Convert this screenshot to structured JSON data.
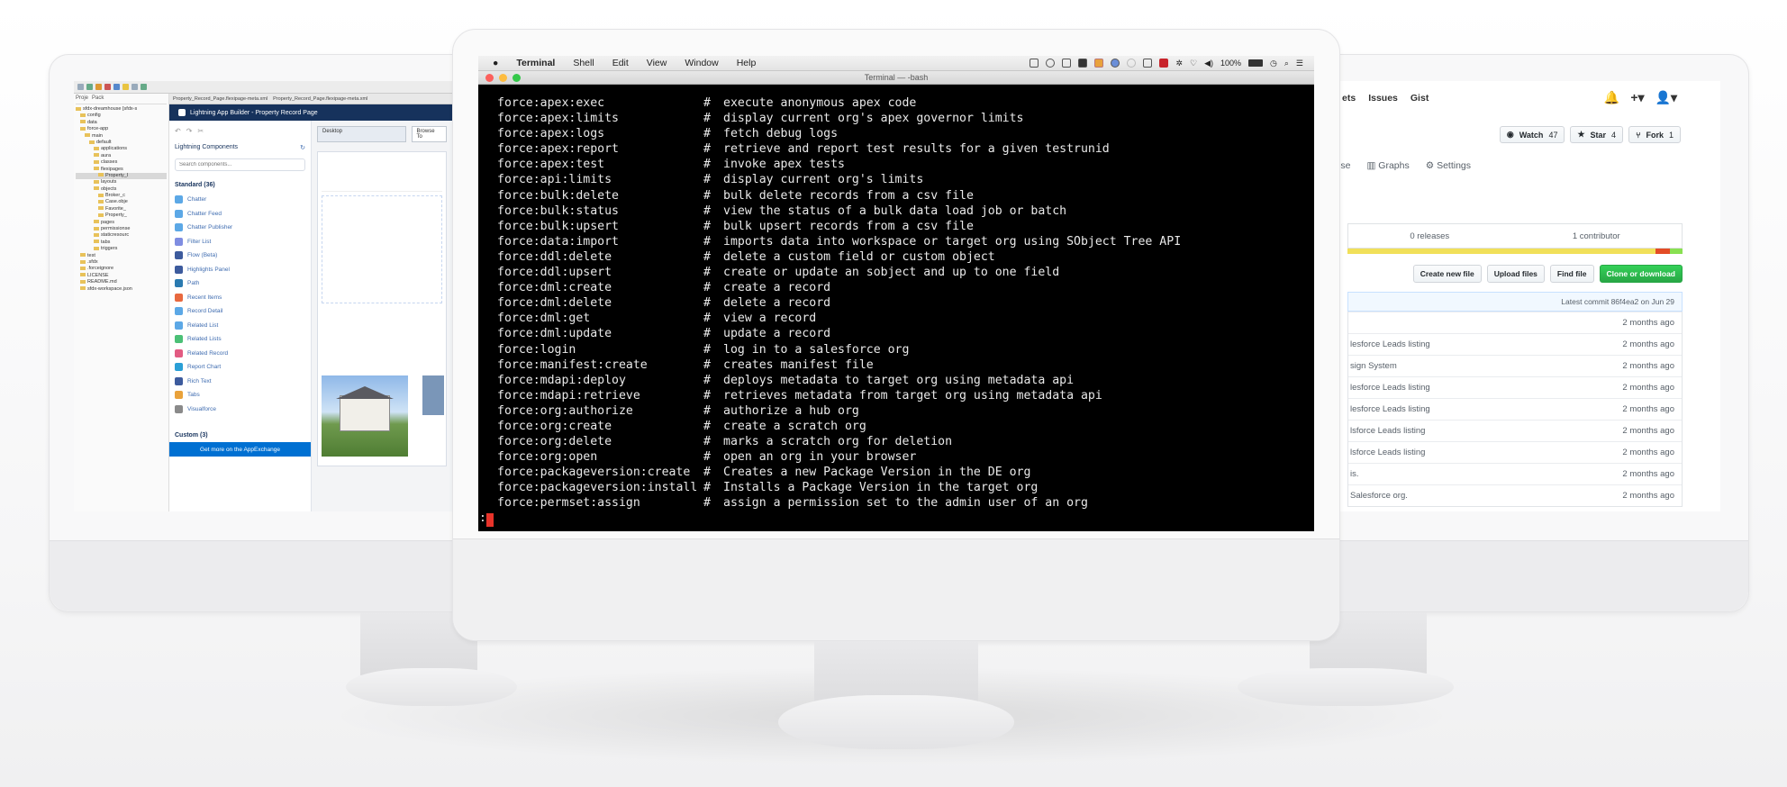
{
  "left_screen": {
    "ide_tabs": [
      "Property_Record_Page.flexipage-meta.xml",
      "Property_Record_Page.flexipage-meta.xml"
    ],
    "tree_tabs": [
      "Proje",
      "Pack"
    ],
    "tree_items": [
      "sfdx-dreamhouse [sfdx-s",
      "config",
      "data",
      "force-app",
      "main",
      "default",
      "applications",
      "aura",
      "classes",
      "flexipages",
      "Property_I",
      "layouts",
      "objects",
      "Broker_c",
      "Case.obje",
      "Favorite_",
      "Property_",
      "pages",
      "permissionse",
      "staticresourc",
      "tabs",
      "triggers",
      "test",
      ".sfdx",
      ".forceignore",
      "LICENSE",
      "README.md",
      "sfdx-workspace.json"
    ],
    "app_header": "Lightning App Builder - Property Record Page",
    "device_select": "Desktop",
    "palette_title": "Lightning Components",
    "palette_search_placeholder": "Search components...",
    "standard_heading": "Standard (36)",
    "components": [
      "Chatter",
      "Chatter Feed",
      "Chatter Publisher",
      "Filter List",
      "Flow (Beta)",
      "Highlights Panel",
      "Path",
      "Recent Items",
      "Record Detail",
      "Related List",
      "Related Lists",
      "Related Record",
      "Report Chart",
      "Rich Text",
      "Tabs",
      "Visualforce"
    ],
    "custom_heading": "Custom (3)",
    "appexchange_link": "Get more on the AppExchange",
    "browse_label": "Browse To"
  },
  "terminal": {
    "menu": {
      "apple": "",
      "app": "Terminal",
      "items": [
        "Shell",
        "Edit",
        "View",
        "Window",
        "Help"
      ],
      "battery": "100%"
    },
    "window_title": "Terminal — -bash",
    "lines": [
      {
        "cmd": "force:apex:exec",
        "desc": "execute anonymous apex code"
      },
      {
        "cmd": "force:apex:limits",
        "desc": "display current org's apex governor limits"
      },
      {
        "cmd": "force:apex:logs",
        "desc": "fetch debug logs"
      },
      {
        "cmd": "force:apex:report",
        "desc": "retrieve and report test results for a given testrunid"
      },
      {
        "cmd": "force:apex:test",
        "desc": "invoke apex tests"
      },
      {
        "cmd": "force:api:limits",
        "desc": "display current org's limits"
      },
      {
        "cmd": "force:bulk:delete",
        "desc": "bulk delete records from a csv file"
      },
      {
        "cmd": "force:bulk:status",
        "desc": "view the status of a bulk data load job or batch"
      },
      {
        "cmd": "force:bulk:upsert",
        "desc": "bulk upsert records from a csv file"
      },
      {
        "cmd": "force:data:import",
        "desc": "imports data into workspace or target org using SObject Tree API"
      },
      {
        "cmd": "force:ddl:delete",
        "desc": "delete a custom field or custom object"
      },
      {
        "cmd": "force:ddl:upsert",
        "desc": "create or update an sobject and up to one field"
      },
      {
        "cmd": "force:dml:create",
        "desc": "create a record"
      },
      {
        "cmd": "force:dml:delete",
        "desc": "delete a record"
      },
      {
        "cmd": "force:dml:get",
        "desc": "view a record"
      },
      {
        "cmd": "force:dml:update",
        "desc": "update a record"
      },
      {
        "cmd": "force:login",
        "desc": "log in to a salesforce org"
      },
      {
        "cmd": "force:manifest:create",
        "desc": "creates manifest file"
      },
      {
        "cmd": "force:mdapi:deploy",
        "desc": "deploys metadata to target org using metadata api"
      },
      {
        "cmd": "force:mdapi:retrieve",
        "desc": "retrieves metadata from target org using metadata api"
      },
      {
        "cmd": "force:org:authorize",
        "desc": "authorize a hub org"
      },
      {
        "cmd": "force:org:create",
        "desc": "create a scratch org"
      },
      {
        "cmd": "force:org:delete",
        "desc": "marks a scratch org for deletion"
      },
      {
        "cmd": "force:org:open",
        "desc": "open an org in your browser"
      },
      {
        "cmd": "force:packageversion:create",
        "desc": "Creates a new Package Version in the DE org"
      },
      {
        "cmd": "force:packageversion:install",
        "desc": "Installs a Package Version in the target org"
      },
      {
        "cmd": "force:permset:assign",
        "desc": "assign a permission set to the admin user of an org"
      }
    ],
    "hash": "#",
    "prompt": ":"
  },
  "right_screen": {
    "nav": [
      "ets",
      "Issues",
      "Gist"
    ],
    "watch": {
      "label": "Watch",
      "count": "47"
    },
    "star": {
      "label": "Star",
      "count": "4"
    },
    "fork": {
      "label": "Fork",
      "count": "1"
    },
    "tabs": [
      "lse",
      "Graphs",
      "Settings"
    ],
    "releases": "0 releases",
    "contributors": "1 contributor",
    "actions": [
      "Create new file",
      "Upload files",
      "Find file",
      "Clone or download"
    ],
    "latest_commit": "Latest commit 86f4ea2 on Jun 29",
    "rows": [
      {
        "msg": "",
        "time": "2 months ago"
      },
      {
        "msg": "lesforce Leads listing",
        "time": "2 months ago"
      },
      {
        "msg": "sign System",
        "time": "2 months ago"
      },
      {
        "msg": "lesforce Leads listing",
        "time": "2 months ago"
      },
      {
        "msg": "lesforce Leads listing",
        "time": "2 months ago"
      },
      {
        "msg": "lsforce Leads listing",
        "time": "2 months ago"
      },
      {
        "msg": "lsforce Leads listing",
        "time": "2 months ago"
      },
      {
        "msg": "is.",
        "time": "2 months ago"
      },
      {
        "msg": "Salesforce org.",
        "time": "2 months ago"
      }
    ]
  },
  "colors": {
    "terminal_bg": "#000000",
    "terminal_fg": "#e9e9e9",
    "salesforce_navy": "#16325c",
    "github_green": "#28a745",
    "cursor": "#e8332a"
  }
}
